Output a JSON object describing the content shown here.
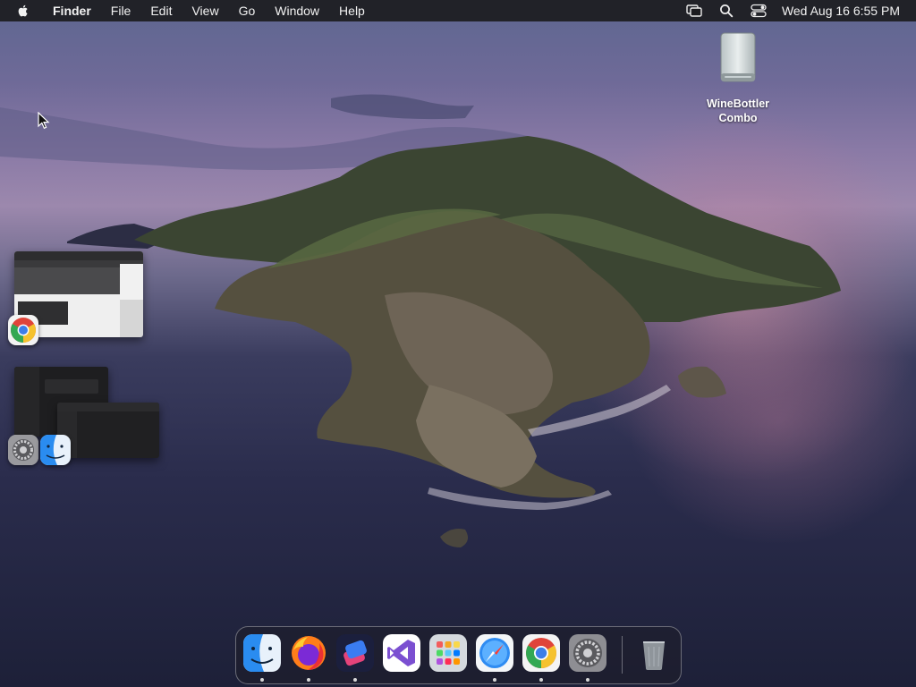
{
  "menubar": {
    "app_name": "Finder",
    "menus": [
      "File",
      "Edit",
      "View",
      "Go",
      "Window",
      "Help"
    ],
    "clock": "Wed Aug 16  6:55 PM",
    "status_icons": [
      "screen-mirroring-icon",
      "spotlight-search-icon",
      "control-center-icon"
    ]
  },
  "desktop": {
    "drive_label_line1": "WineBottler",
    "drive_label_line2": "Combo",
    "drive_icon": "external-drive-icon"
  },
  "stage_manager": {
    "groups": [
      {
        "apps": [
          "chrome"
        ]
      },
      {
        "apps": [
          "system-settings",
          "finder"
        ]
      }
    ]
  },
  "dock": {
    "items": [
      {
        "name": "finder",
        "running": true
      },
      {
        "name": "firefox",
        "running": true
      },
      {
        "name": "shortcuts",
        "running": true
      },
      {
        "name": "visual-studio",
        "running": false
      },
      {
        "name": "launchpad",
        "running": false
      },
      {
        "name": "safari",
        "running": true
      },
      {
        "name": "chrome",
        "running": true
      },
      {
        "name": "system-settings",
        "running": true
      },
      {
        "name": "trash",
        "running": false
      }
    ]
  },
  "colors": {
    "menubar_bg": "#1c1c20",
    "finder_blue": "#2a8cf0",
    "chrome_red": "#e0443a",
    "chrome_yellow": "#f5c22e",
    "chrome_green": "#33a853",
    "chrome_blue": "#3d7ee8"
  }
}
